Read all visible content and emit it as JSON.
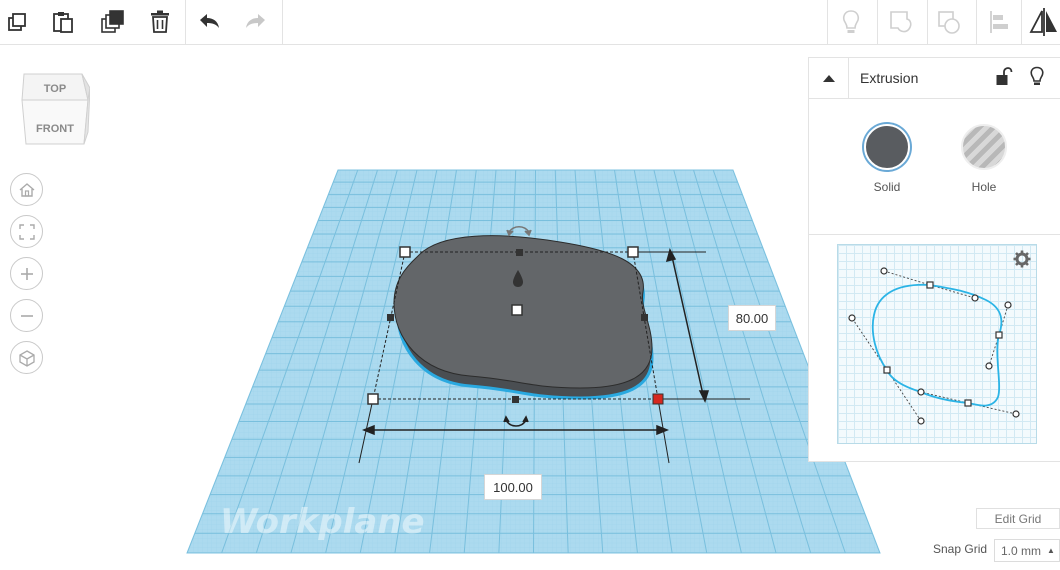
{
  "toolbar": {
    "left_icons": [
      "copy-icon",
      "paste-icon",
      "duplicate-icon",
      "delete-icon",
      "undo-icon",
      "redo-icon"
    ],
    "right_icons": [
      "show-all-icon",
      "group-icon",
      "ungroup-icon",
      "align-icon",
      "mirror-icon"
    ]
  },
  "viewcube": {
    "top_label": "TOP",
    "front_label": "FRONT"
  },
  "workplane": {
    "label": "Workplane"
  },
  "dimensions": {
    "width": "100.00",
    "depth": "80.00"
  },
  "panel": {
    "title": "Extrusion",
    "solid_label": "Solid",
    "hole_label": "Hole"
  },
  "grid": {
    "edit_label": "Edit Grid",
    "snap_label": "Snap Grid",
    "snap_value": "1.0 mm"
  },
  "colors": {
    "workplane_fill": "#a8d8ec",
    "workplane_grid": "#7cc3e0",
    "shape_fill": "#5f6367",
    "selection_outline": "#2aa9e0",
    "handle_red": "#d6281f",
    "curve_stroke": "#2bb4e6"
  }
}
